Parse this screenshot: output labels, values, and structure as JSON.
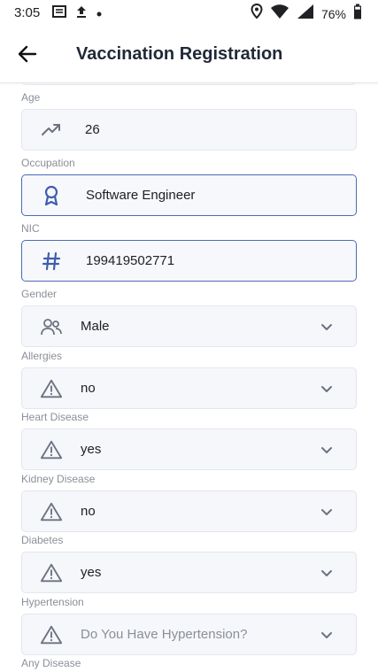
{
  "status_bar": {
    "time": "3:05",
    "battery": "76%",
    "icons": [
      "news-icon",
      "upload-icon",
      "dot-icon",
      "location-icon",
      "wifi-icon",
      "signal-icon",
      "battery-icon"
    ]
  },
  "app_bar": {
    "back_icon": "arrow-left-icon",
    "title": "Vaccination Registration"
  },
  "fields": {
    "age": {
      "label": "Age",
      "value": "26",
      "icon": "trending-up-icon"
    },
    "occupation": {
      "label": "Occupation",
      "value": "Software Engineer",
      "icon": "award-icon"
    },
    "nic": {
      "label": "NIC",
      "value": "199419502771",
      "icon": "hash-icon"
    },
    "gender": {
      "label": "Gender",
      "value": "Male",
      "icon": "users-icon"
    },
    "allergies": {
      "label": "Allergies",
      "value": "no",
      "icon": "warning-icon"
    },
    "heart_disease": {
      "label": "Heart Disease",
      "value": "yes",
      "icon": "warning-icon"
    },
    "kidney_disease": {
      "label": "Kidney Disease",
      "value": "no",
      "icon": "warning-icon"
    },
    "diabetes": {
      "label": "Diabetes",
      "value": "yes",
      "icon": "warning-icon"
    },
    "hypertension": {
      "label": "Hypertension",
      "placeholder": "Do You Have Hypertension?",
      "icon": "warning-icon"
    },
    "any_disease": {
      "label": "Any Disease"
    }
  },
  "colors": {
    "active_border": "#4b6bb7",
    "icon_blue": "#3f5fae",
    "icon_gray": "#6b7280",
    "field_bg": "#f6f7fb",
    "label_gray": "#8a8f98"
  }
}
